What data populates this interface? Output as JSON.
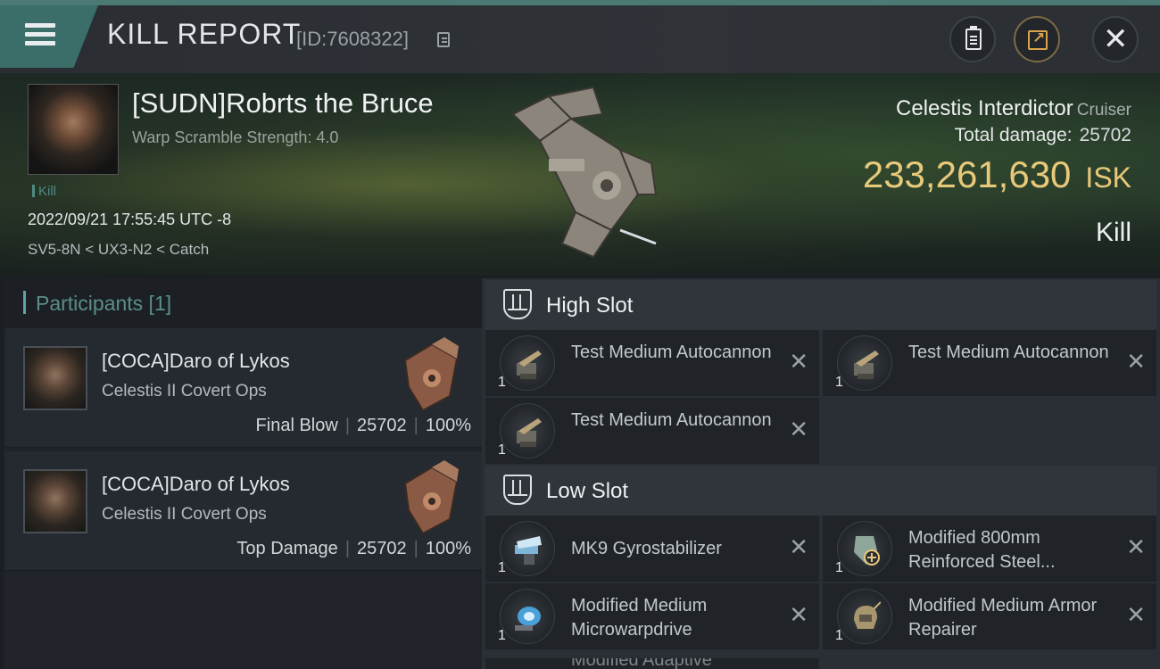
{
  "header": {
    "title": "KILL REPORT",
    "kill_id": "[ID:7608322]",
    "icons": [
      "menu-icon",
      "copy-icon",
      "clipboard-icon",
      "share-icon",
      "close-icon"
    ]
  },
  "victim": {
    "name": "[SUDN]Robrts the Bruce",
    "scramble": "Warp Scramble Strength: 4.0",
    "tag": "Kill",
    "datetime": "2022/09/21 17:55:45 UTC -8",
    "location": "SV5-8N < UX3-N2 < Catch",
    "ship_name": "Celestis Interdictor",
    "ship_category": "Cruiser",
    "total_damage_label": "Total damage:",
    "total_damage": "25702",
    "isk_value": "233,261,630",
    "isk_unit": "ISK",
    "result": "Kill"
  },
  "participants": {
    "label": "Participants [1]",
    "items": [
      {
        "name": "[COCA]Daro of Lykos",
        "ship": "Celestis II Covert Ops",
        "role": "Final Blow",
        "damage": "25702",
        "percent": "100%"
      },
      {
        "name": "[COCA]Daro of Lykos",
        "ship": "Celestis II Covert Ops",
        "role": "Top Damage",
        "damage": "25702",
        "percent": "100%"
      }
    ]
  },
  "slots": {
    "high": {
      "label": "High Slot",
      "modules": [
        {
          "name": "Test Medium Autocannon",
          "qty": "1"
        },
        {
          "name": "Test Medium Autocannon",
          "qty": "1"
        },
        {
          "name": "Test Medium Autocannon",
          "qty": "1"
        }
      ]
    },
    "low": {
      "label": "Low Slot",
      "modules": [
        {
          "name": "MK9 Gyrostabilizer",
          "qty": "1"
        },
        {
          "name": "Modified 800mm Reinforced Steel...",
          "qty": "1"
        },
        {
          "name": "Modified Medium Microwarpdrive",
          "qty": "1"
        },
        {
          "name": "Modified Medium Armor Repairer",
          "qty": "1"
        }
      ],
      "partial_next": "Modified Adaptive"
    }
  },
  "close_glyph": "✕",
  "colors": {
    "accent": "#4e8a84",
    "isk": "#e8c97a",
    "header_tab": "#3b6e69"
  }
}
